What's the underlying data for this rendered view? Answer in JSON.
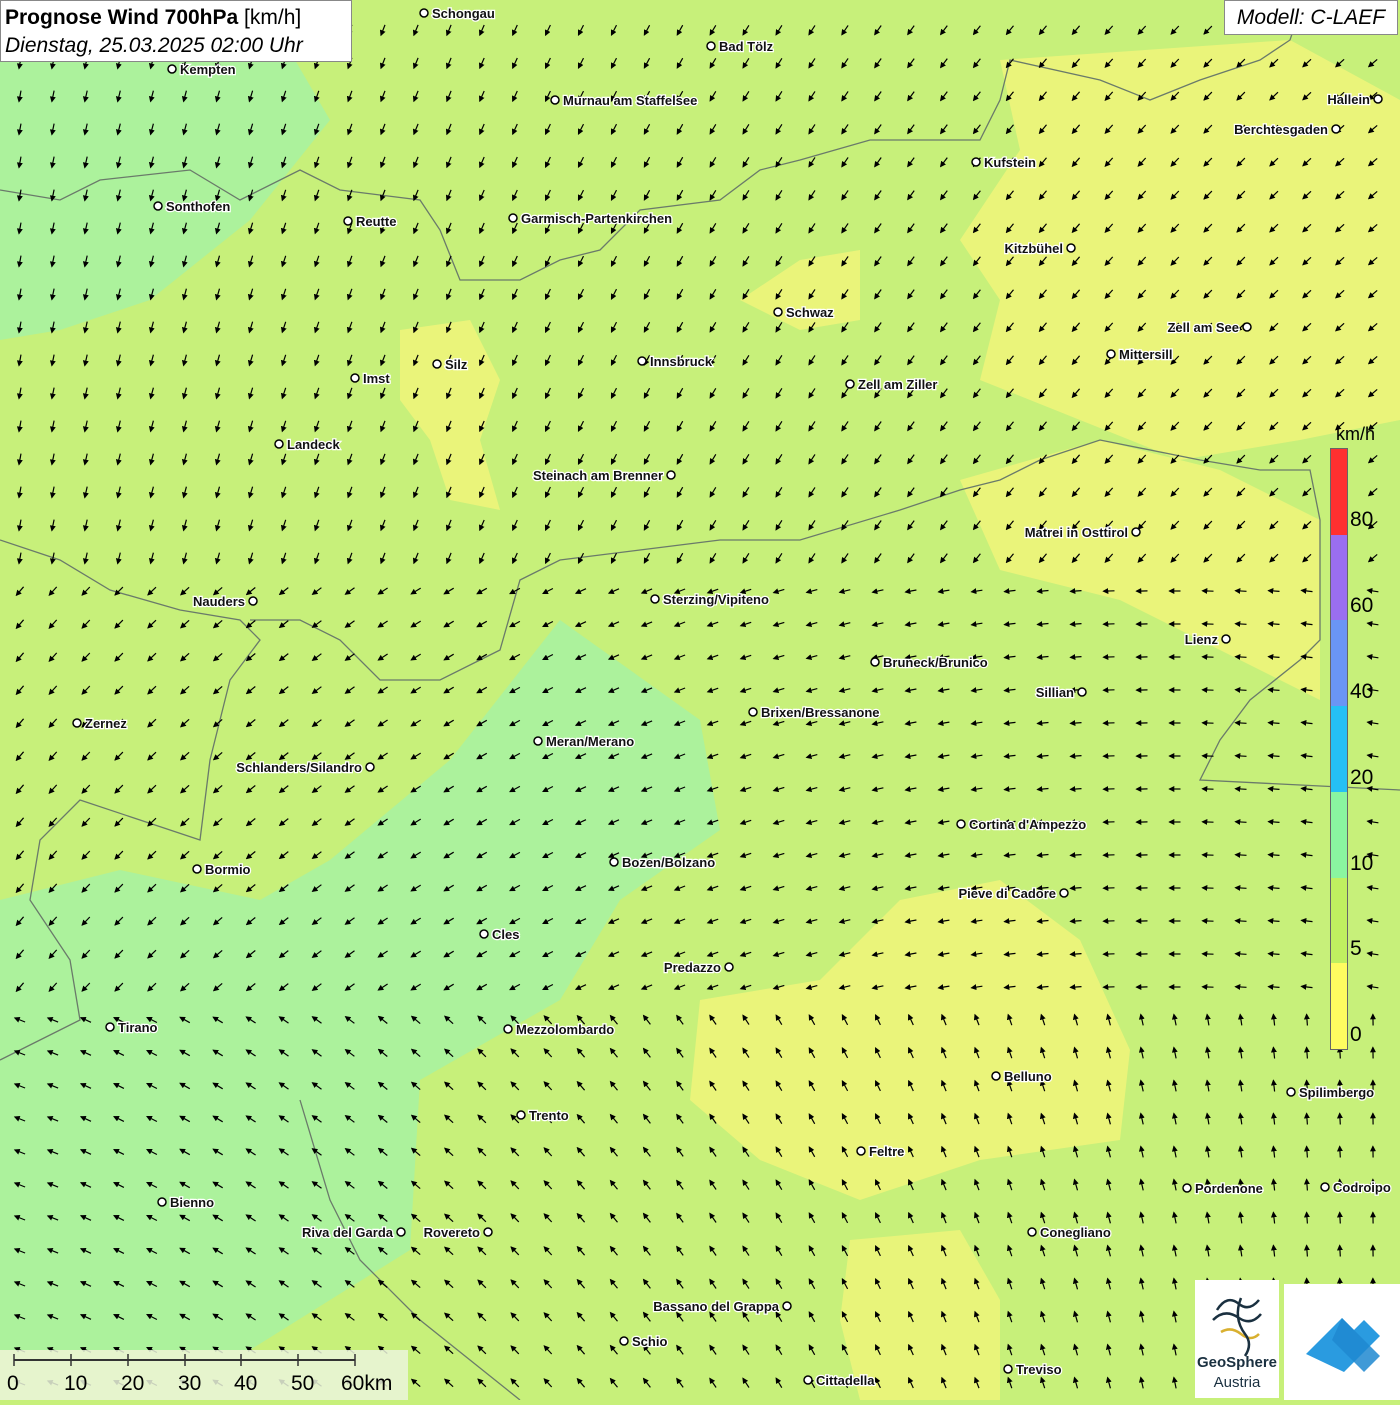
{
  "title": {
    "bold": "Prognose Wind 700hPa",
    "unit": "[km/h]",
    "datetime": "Dienstag, 25.03.2025 02:00 Uhr"
  },
  "model": "Modell: C-LAEF",
  "legend": {
    "unit": "km/h",
    "labels": [
      "80",
      "60",
      "40",
      "20",
      "10",
      "5",
      "0"
    ],
    "colors": [
      "#ff3030",
      "#9a6ef0",
      "#6a95f5",
      "#25c0f5",
      "#8af5a0",
      "#c0f060",
      "#fffc60"
    ]
  },
  "scale_bar": {
    "labels": [
      "0",
      "10",
      "20",
      "30",
      "40",
      "50",
      "60km"
    ]
  },
  "logo": {
    "name": "GeoSphere",
    "sub": "Austria"
  },
  "cities": [
    {
      "name": "Schongau"
    },
    {
      "name": "Bad Tölz"
    },
    {
      "name": "Kempten"
    },
    {
      "name": "Murnau am Staffelsee"
    },
    {
      "name": "Hallein"
    },
    {
      "name": "Berchtesgaden"
    },
    {
      "name": "Kufstein"
    },
    {
      "name": "Sonthofen"
    },
    {
      "name": "Reutte"
    },
    {
      "name": "Garmisch-Partenkirchen"
    },
    {
      "name": "Kitzbühel"
    },
    {
      "name": "Schwaz"
    },
    {
      "name": "Zell am See"
    },
    {
      "name": "Mittersill"
    },
    {
      "name": "Imst"
    },
    {
      "name": "Silz"
    },
    {
      "name": "Innsbruck"
    },
    {
      "name": "Zell am Ziller"
    },
    {
      "name": "Landeck"
    },
    {
      "name": "Steinach am Brenner"
    },
    {
      "name": "Matrei in Osttirol"
    },
    {
      "name": "Nauders"
    },
    {
      "name": "Sterzing/Vipiteno"
    },
    {
      "name": "Lienz"
    },
    {
      "name": "Bruneck/Brunico"
    },
    {
      "name": "Sillian"
    },
    {
      "name": "Zernez"
    },
    {
      "name": "Brixen/Bressanone"
    },
    {
      "name": "Meran/Merano"
    },
    {
      "name": "Schlanders/Silandro"
    },
    {
      "name": "Cortina d'Ampezzo"
    },
    {
      "name": "Bozen/Bolzano"
    },
    {
      "name": "Bormio"
    },
    {
      "name": "Pieve di Cadore"
    },
    {
      "name": "Cles"
    },
    {
      "name": "Predazzo"
    },
    {
      "name": "Tirano"
    },
    {
      "name": "Mezzolombardo"
    },
    {
      "name": "Belluno"
    },
    {
      "name": "Spilimbergo"
    },
    {
      "name": "Trento"
    },
    {
      "name": "Feltre"
    },
    {
      "name": "Pordenone"
    },
    {
      "name": "Codroipo"
    },
    {
      "name": "Bienno"
    },
    {
      "name": "Riva del Garda"
    },
    {
      "name": "Rovereto"
    },
    {
      "name": "Conegliano"
    },
    {
      "name": "Bassano del Grappa"
    },
    {
      "name": "Schio"
    },
    {
      "name": "Treviso"
    },
    {
      "name": "Cittadella"
    }
  ]
}
